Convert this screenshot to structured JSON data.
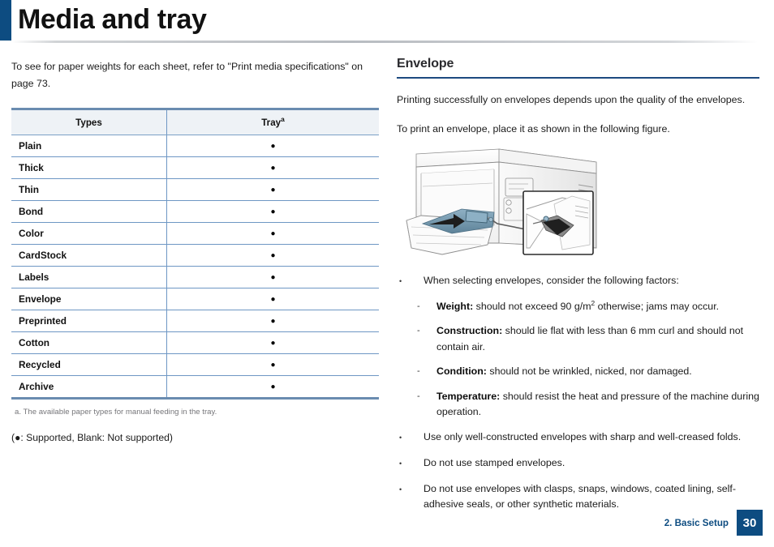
{
  "header": {
    "title": "Media and tray",
    "accent_color": "#0d4c81"
  },
  "left_column": {
    "intro_text": "To see for paper weights for each sheet, refer to \"Print media specifications\" on page 73.",
    "table": {
      "columns": [
        "Types",
        "Tray"
      ],
      "tray_footnote_marker": "a",
      "rows": [
        {
          "type": "Plain",
          "tray": "●"
        },
        {
          "type": "Thick",
          "tray": "●"
        },
        {
          "type": "Thin",
          "tray": "●"
        },
        {
          "type": "Bond",
          "tray": "●"
        },
        {
          "type": "Color",
          "tray": "●"
        },
        {
          "type": "CardStock",
          "tray": "●"
        },
        {
          "type": "Labels",
          "tray": "●"
        },
        {
          "type": "Envelope",
          "tray": "●"
        },
        {
          "type": "Preprinted",
          "tray": "●"
        },
        {
          "type": "Cotton",
          "tray": "●"
        },
        {
          "type": "Recycled",
          "tray": "●"
        },
        {
          "type": "Archive",
          "tray": "●"
        }
      ],
      "footnote": "a.  The available paper types for manual feeding in the tray.",
      "legend_prefix": "(",
      "legend_dot": "●",
      "legend_text": ": Supported, Blank: Not supported)"
    }
  },
  "right_column": {
    "heading": "Envelope",
    "rule_color": "#1d4a80",
    "intro_1": "Printing successfully on envelopes depends upon the quality of the envelopes.",
    "intro_2": "To print an envelope, place it as shown in the following figure.",
    "figure_caption": "",
    "bullets": [
      {
        "marker": "•",
        "text": "When selecting envelopes, consider the following factors:",
        "sub_items": [
          {
            "marker": "-",
            "term": "Weight:",
            "text_before_sup": " should not exceed 90 g/m",
            "sup": "2",
            "text_after_sup": " otherwise; jams may occur."
          },
          {
            "marker": "-",
            "term": "Construction:",
            "text_before_sup": " should lie flat with less than 6 mm curl and should not contain air.",
            "sup": "",
            "text_after_sup": ""
          },
          {
            "marker": "-",
            "term": "Condition:",
            "text_before_sup": " should not be wrinkled, nicked, nor damaged.",
            "sup": "",
            "text_after_sup": ""
          },
          {
            "marker": "-",
            "term": "Temperature:",
            "text_before_sup": " should resist the heat and pressure of the machine during operation.",
            "sup": "",
            "text_after_sup": ""
          }
        ]
      },
      {
        "marker": "•",
        "text": "Use only well-constructed envelopes with sharp and well-creased folds.",
        "sub_items": []
      },
      {
        "marker": "•",
        "text": "Do not use stamped envelopes.",
        "sub_items": []
      },
      {
        "marker": "•",
        "text": "Do not use envelopes with clasps, snaps, windows, coated lining, self-adhesive seals, or other synthetic materials.",
        "sub_items": []
      }
    ]
  },
  "footer": {
    "chapter": "2. Basic Setup",
    "page_number": "30",
    "badge_color": "#0d4c81"
  }
}
